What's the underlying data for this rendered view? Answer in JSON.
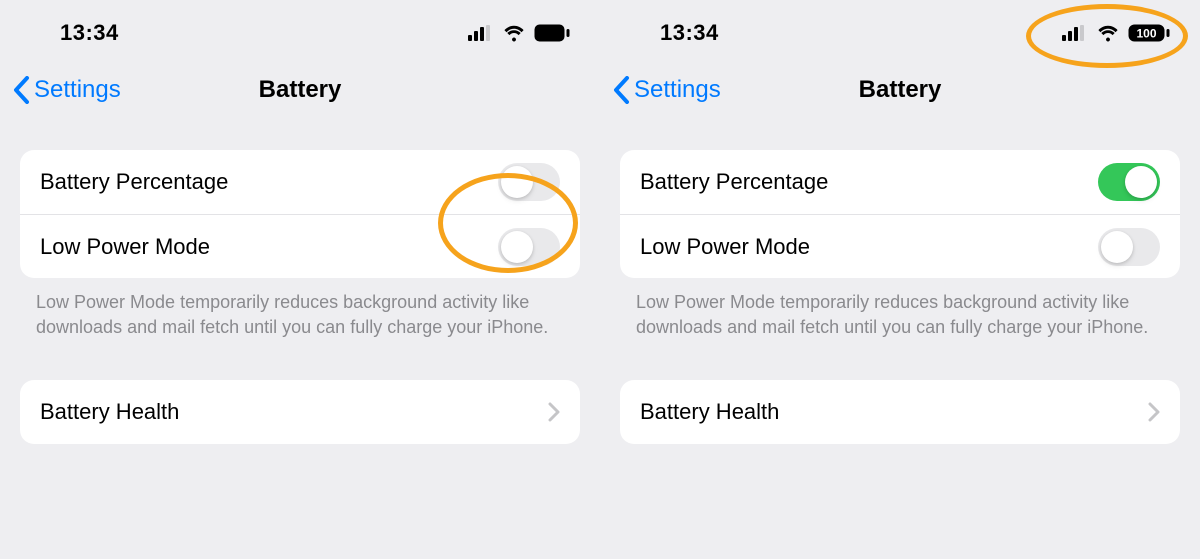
{
  "left": {
    "status": {
      "time": "13:34",
      "battery_shows_percent": false
    },
    "nav": {
      "back_label": "Settings",
      "title": "Battery"
    },
    "rows": {
      "battery_percentage": {
        "label": "Battery Percentage",
        "on": false
      },
      "low_power_mode": {
        "label": "Low Power Mode",
        "on": false
      }
    },
    "footer": "Low Power Mode temporarily reduces background activity like downloads and mail fetch until you can fully charge your iPhone.",
    "battery_health": {
      "label": "Battery Health"
    }
  },
  "right": {
    "status": {
      "time": "13:34",
      "battery_shows_percent": true,
      "battery_percent": "100"
    },
    "nav": {
      "back_label": "Settings",
      "title": "Battery"
    },
    "rows": {
      "battery_percentage": {
        "label": "Battery Percentage",
        "on": true
      },
      "low_power_mode": {
        "label": "Low Power Mode",
        "on": false
      }
    },
    "footer": "Low Power Mode temporarily reduces background activity like downloads and mail fetch until you can fully charge your iPhone.",
    "battery_health": {
      "label": "Battery Health"
    }
  }
}
